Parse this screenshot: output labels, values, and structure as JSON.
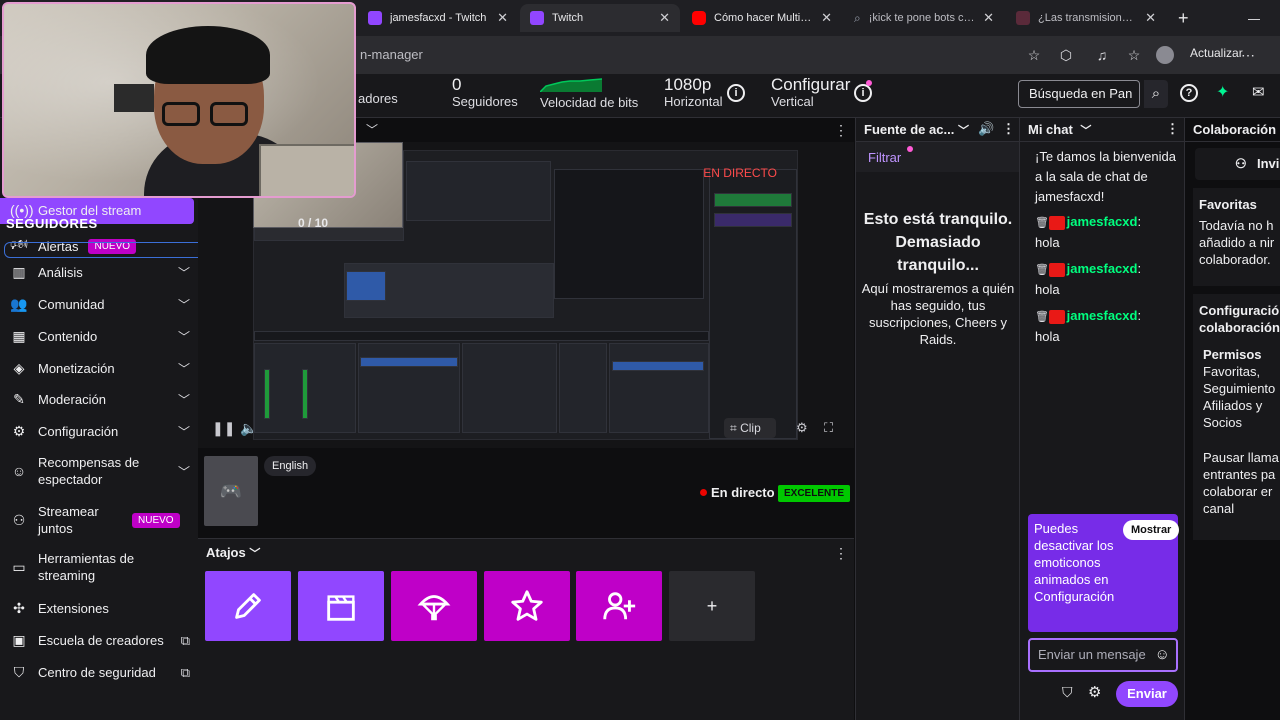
{
  "browser": {
    "tabs": [
      {
        "title": "jamesfacxd - Twitch",
        "favicon": "twitch-icon",
        "active": false
      },
      {
        "title": "Twitch",
        "favicon": "twitch-icon",
        "active": true
      },
      {
        "title": "Cómo hacer MultiStrea",
        "favicon": "youtube-icon",
        "active": false
      },
      {
        "title": "¡kick te pone bots cuan",
        "favicon": "search-icon",
        "active": false
      },
      {
        "title": "¿Las transmisiones de M",
        "favicon": "page-icon",
        "active": false
      }
    ],
    "url_visible": "n-manager",
    "update_label": "Actualizar"
  },
  "header": {
    "viewers_partial": "adores",
    "followers_value": "0",
    "followers_label": "Seguidores",
    "bitrate_label": "Velocidad de bits",
    "resolution_value": "1080p",
    "resolution_label": "Horizontal",
    "configure_value": "Configurar",
    "configure_label": "Vertical",
    "search_placeholder": "Búsqueda en Pan"
  },
  "sidebar": {
    "overlay_heading": "SEGUIDORES",
    "items": [
      {
        "label": "Gestor del stream",
        "icon": "broadcast-icon"
      },
      {
        "label": "Alertas",
        "icon": "alert-icon",
        "badge": "NUEVO"
      },
      {
        "label": "Análisis",
        "icon": "analytics-icon"
      },
      {
        "label": "Comunidad",
        "icon": "community-icon"
      },
      {
        "label": "Contenido",
        "icon": "content-icon"
      },
      {
        "label": "Monetización",
        "icon": "monetization-icon"
      },
      {
        "label": "Moderación",
        "icon": "moderation-icon"
      },
      {
        "label": "Configuración",
        "icon": "gear-icon"
      },
      {
        "label": "Recompensas de espectador",
        "icon": "rewards-icon"
      },
      {
        "label": "Streamear juntos",
        "icon": "add-user-icon",
        "badge": "NUEVO"
      },
      {
        "label": "Herramientas de streaming",
        "icon": "camera-icon"
      },
      {
        "label": "Extensiones",
        "icon": "puzzle-icon"
      },
      {
        "label": "Escuela de creadores",
        "icon": "book-icon"
      },
      {
        "label": "Centro de seguridad",
        "icon": "shield-icon"
      }
    ]
  },
  "player": {
    "obs_live": "EN DIRECTO",
    "followers_counter": "0 / 10",
    "clip_label": "Clip"
  },
  "stream": {
    "language": "English",
    "status": "En directo",
    "quality": "EXCELENTE"
  },
  "shortcuts": {
    "title": "Atajos",
    "add": "+"
  },
  "activity": {
    "title": "Fuente de ac...",
    "filter": "Filtrar",
    "calm_title": "Esto está tranquilo. Demasiado tranquilo...",
    "calm_body": "Aquí mostraremos a quién has seguido, tus suscripciones, Cheers y Raids."
  },
  "chat": {
    "title": "Mi chat",
    "welcome": "¡Te damos la bienvenida a la sala de chat de jamesfacxd!",
    "messages": [
      {
        "user": "jamesfacxd",
        "text": "hola"
      },
      {
        "user": "jamesfacxd",
        "text": "hola"
      },
      {
        "user": "jamesfacxd",
        "text": "hola"
      }
    ],
    "promo": "Puedes desactivar los emoticonos animados en Configuración",
    "show_button": "Mostrar",
    "input_placeholder": "Enviar un mensaje",
    "send_button": "Enviar"
  },
  "collab": {
    "title": "Colaboración",
    "invite": "Invi",
    "fav_title": "Favoritas",
    "fav_body": "Todavía no h añadido a nir colaborador.",
    "config_title": "Configuració colaboración",
    "perm_title": "Permisos",
    "perm_body": "Favoritas, Seguimiento Afiliados y Socios",
    "pause_body": "Pausar llama entrantes pa colaborar er canal"
  },
  "colors": {
    "accent_purple": "#9147ff",
    "magenta": "#bf00c8",
    "live_red": "#eb0400",
    "chat_username": "#00ff7f",
    "excellent_green": "#00c800"
  }
}
